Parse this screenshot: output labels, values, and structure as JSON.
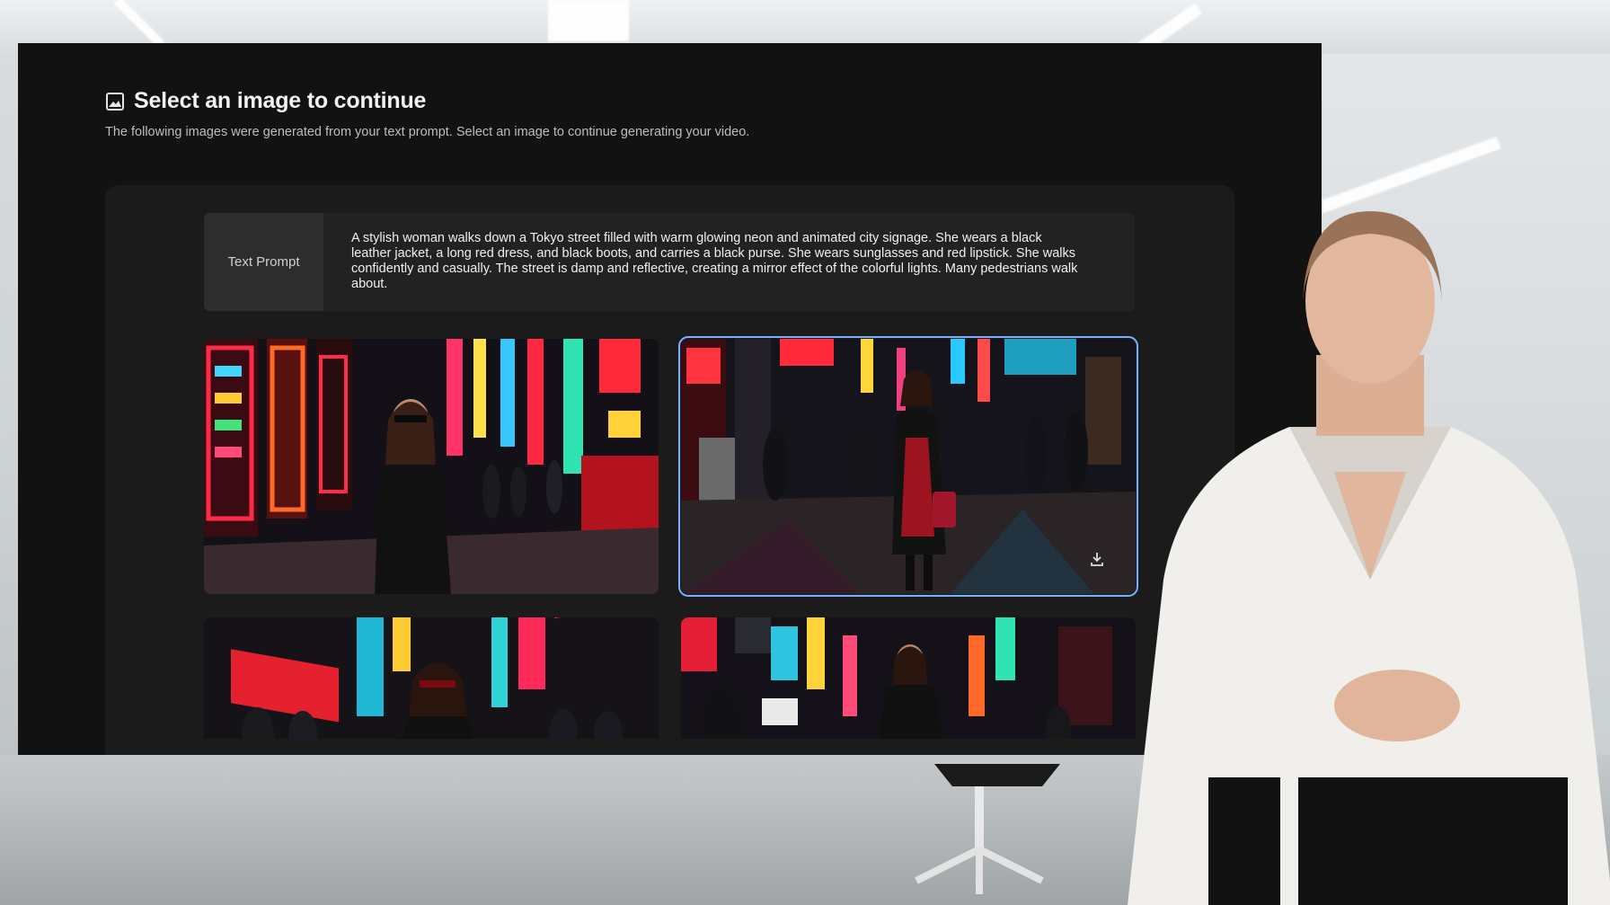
{
  "page": {
    "title": "Select an image to continue",
    "subtitle": "The following images were generated from your text prompt. Select an image to continue generating your video.",
    "title_icon": "image-icon"
  },
  "prompt": {
    "label": "Text Prompt",
    "text": "A stylish woman walks down a Tokyo street filled with warm glowing neon and animated city signage. She wears a black leather jacket, a long red dress, and black boots, and carries a black purse. She wears sunglasses and red lipstick. She walks confidently and casually. The street is damp and reflective, creating a mirror effect of the colorful lights. Many pedestrians walk about."
  },
  "images": [
    {
      "selected": false
    },
    {
      "selected": true,
      "action_icon": "download-icon"
    },
    {
      "selected": false
    },
    {
      "selected": false
    }
  ],
  "colors": {
    "window_bg": "#121212",
    "panel_bg": "#1b1b1b",
    "selection_outline": "#7ab0ff",
    "neon_red": "#e8213f",
    "neon_cyan": "#2fd3d6"
  }
}
